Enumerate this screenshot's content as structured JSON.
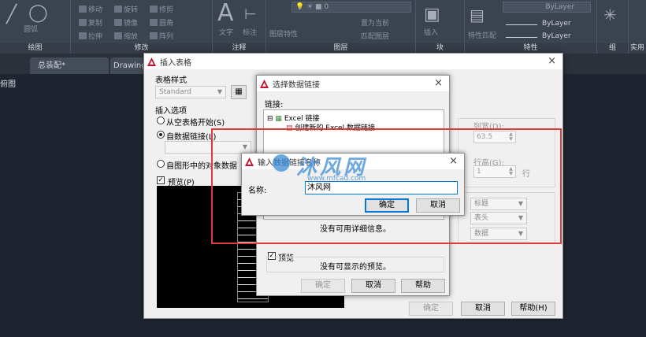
{
  "ribbon": {
    "panels": [
      {
        "title": "绘图"
      },
      {
        "title": "修改"
      },
      {
        "title": "注释"
      },
      {
        "title": "图层"
      },
      {
        "title": "块"
      },
      {
        "title": "特性"
      },
      {
        "title": "组"
      },
      {
        "title": "实用"
      }
    ],
    "draw_items": [
      "圆弧"
    ],
    "modify_items": [
      "移动",
      "旋转",
      "修剪",
      "复制",
      "镜像",
      "圆角",
      "拉伸",
      "缩放",
      "阵列"
    ],
    "annotation_items": [
      "文字",
      "标注"
    ],
    "layer_items": [
      "图层特性",
      "置为当前",
      "匹配图层"
    ],
    "block_items": [
      "插入"
    ],
    "properties_items": [
      "特性匹配"
    ],
    "bylayer": [
      "ByLayer",
      "ByLayer",
      "ByLayer"
    ]
  },
  "tabs": [
    {
      "label": "总装配*"
    },
    {
      "label": "Drawing"
    }
  ],
  "viewport_label": "俯图",
  "insert_table": {
    "title": "插入表格",
    "table_style_label": "表格样式",
    "table_style_value": "Standard",
    "insert_options_label": "插入选项",
    "opt_empty": "从空表格开始(S)",
    "opt_link": "自数据链接(L)",
    "opt_objects": "自图形中的对象数据",
    "preview_label": "预览(P)",
    "col_width_label": "列宽(D):",
    "col_width_value": "63.5",
    "row_height_label": "行高(G):",
    "row_height_value": "1",
    "row_unit": "行",
    "cell_styles": [
      "标题",
      "表头",
      "数据"
    ],
    "ok": "确定",
    "cancel": "取消",
    "help": "帮助(H)"
  },
  "select_link": {
    "title": "选择数据链接",
    "links_label": "链接:",
    "tree_root": "Excel 链接",
    "tree_child": "创建新的 Excel 数据链接",
    "no_details": "没有可用详细信息。",
    "preview_label": "预览",
    "no_preview": "没有可显示的预览。",
    "ok": "确定",
    "cancel": "取消",
    "help": "帮助"
  },
  "new_link": {
    "title": "输入数据链接名称",
    "name_label": "名称:",
    "name_value": "沐风网",
    "ok": "确定",
    "cancel": "取消"
  },
  "watermark": {
    "text": "沐风网",
    "url": "www.mfcad.com"
  },
  "colors": {
    "accent": "#0078d7",
    "highlight_box": "#e03a3a",
    "autocad_red": "#c8102e"
  }
}
